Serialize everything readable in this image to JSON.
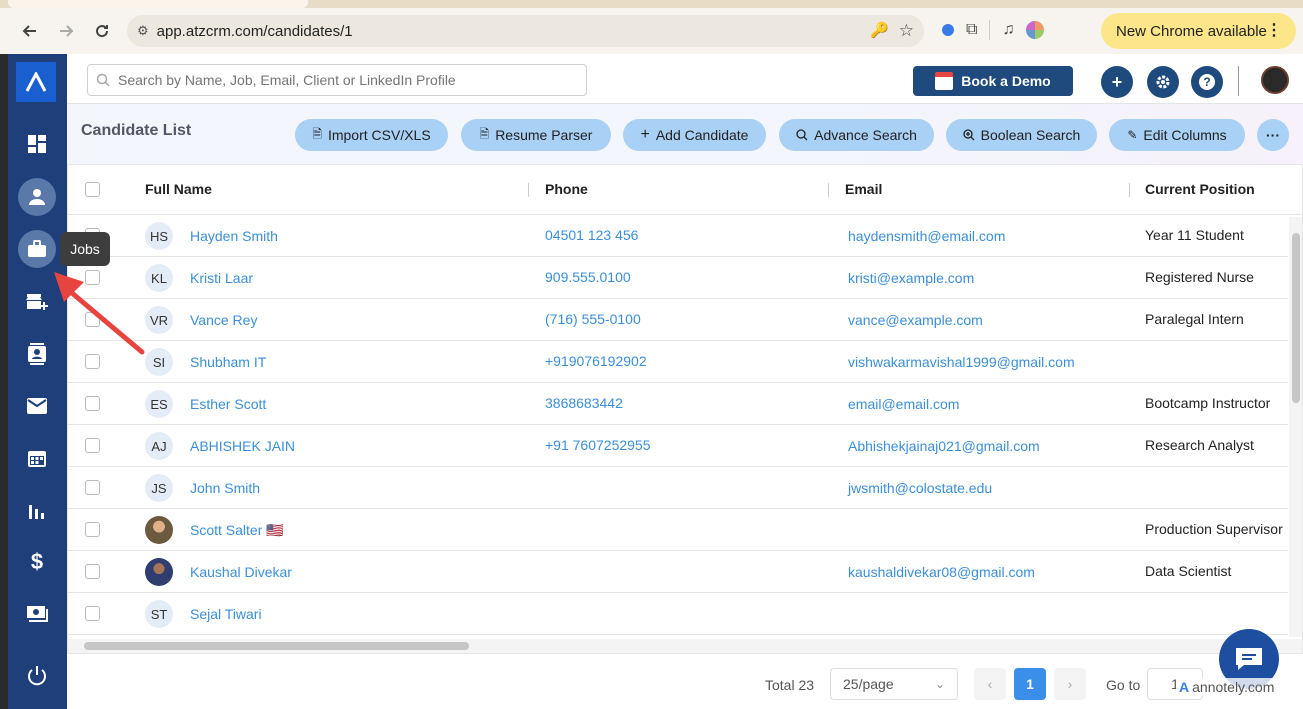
{
  "browser": {
    "url": "app.atzcrm.com/candidates/1",
    "update_label": "New Chrome available"
  },
  "header": {
    "search_placeholder": "Search by Name, Job, Email, Client or LinkedIn Profile",
    "demo_label": "Book a Demo",
    "add_icon": "plus-icon",
    "settings_icon": "gear-icon",
    "help_icon": "help-icon"
  },
  "sidebar": {
    "tooltip": "Jobs",
    "icons": [
      "dashboard-icon",
      "person-icon",
      "briefcase-icon",
      "store-add-icon",
      "contacts-icon",
      "mail-icon",
      "calendar-icon",
      "reports-icon",
      "dollar-icon",
      "money-icon",
      "power-icon"
    ]
  },
  "list": {
    "title": "Candidate List",
    "actions": [
      "Import CSV/XLS",
      "Resume Parser",
      "Add Candidate",
      "Advance Search",
      "Boolean Search",
      "Edit Columns"
    ],
    "more_icon": "more-dots-icon"
  },
  "table": {
    "columns": [
      "Full Name",
      "Phone",
      "Email",
      "Current Position"
    ],
    "rows": [
      {
        "initials": "HS",
        "name": "Hayden Smith",
        "phone": "04501 123 456",
        "email": "haydensmith@email.com",
        "position": "Year 11 Student"
      },
      {
        "initials": "KL",
        "name": "Kristi Laar",
        "phone": "909.555.0100",
        "email": "kristi@example.com",
        "position": "Registered Nurse"
      },
      {
        "initials": "VR",
        "name": "Vance Rey",
        "phone": "(716) 555-0100",
        "email": "vance@example.com",
        "position": "Paralegal Intern"
      },
      {
        "initials": "SI",
        "name": "Shubham IT",
        "phone": "+919076192902",
        "email": "vishwakarmavishal1999@gmail.com",
        "position": ""
      },
      {
        "initials": "ES",
        "name": "Esther Scott",
        "phone": "3868683442",
        "email": "email@email.com",
        "position": "Bootcamp Instructor"
      },
      {
        "initials": "AJ",
        "name": "ABHISHEK JAIN",
        "phone": "+91 7607252955",
        "email": "Abhishekjainaj021@gmail.com",
        "position": "Research Analyst"
      },
      {
        "initials": "JS",
        "name": "John Smith",
        "phone": "",
        "email": "jwsmith@colostate.edu",
        "position": ""
      },
      {
        "initials": "",
        "name": "Scott Salter 🇺🇸",
        "phone": "",
        "email": "",
        "position": "Production Supervisor"
      },
      {
        "initials": "",
        "name": "Kaushal Divekar",
        "phone": "",
        "email": "kaushaldivekar08@gmail.com",
        "position": "Data Scientist"
      },
      {
        "initials": "ST",
        "name": "Sejal Tiwari",
        "phone": "",
        "email": "",
        "position": ""
      }
    ]
  },
  "pagination": {
    "total": "Total 23",
    "per_page": "25/page",
    "current_page": "1",
    "goto_label": "Go to",
    "goto_value": "1"
  },
  "watermark": "annotely.com",
  "colors": {
    "sidebar": "#1e3f7a",
    "accent": "#3b8fe8",
    "pill": "#a9d0f5",
    "link": "#3b8fd9",
    "annotation_arrow": "#e8443f"
  }
}
